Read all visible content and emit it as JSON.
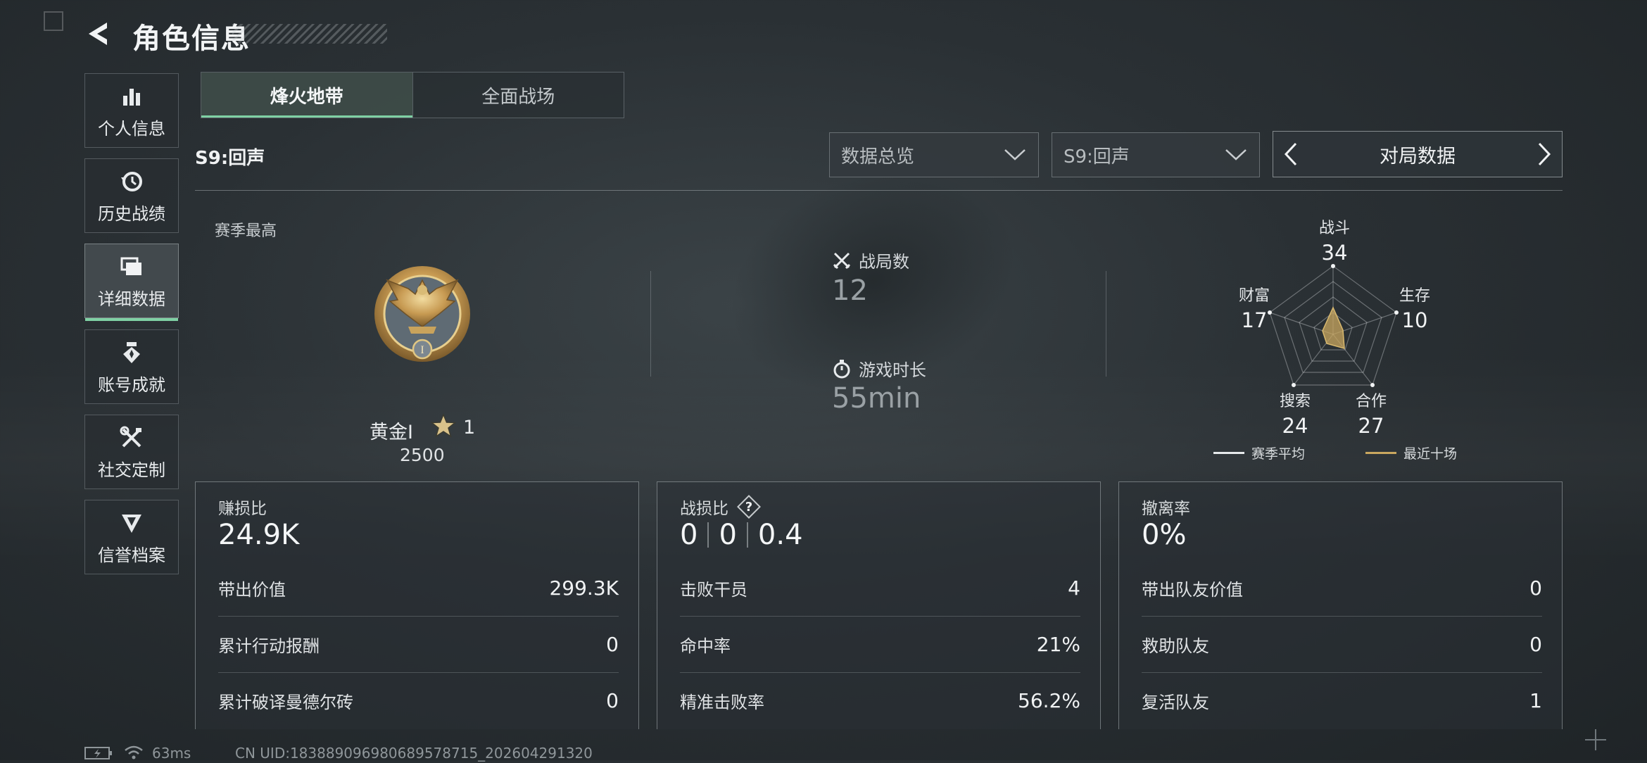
{
  "header": {
    "title": "角色信息"
  },
  "sidebar": {
    "items": [
      {
        "label": "个人信息",
        "icon": "bar-chart-icon"
      },
      {
        "label": "历史战绩",
        "icon": "history-clock-icon"
      },
      {
        "label": "详细数据",
        "icon": "folders-icon",
        "active": true
      },
      {
        "label": "账号成就",
        "icon": "medal-icon"
      },
      {
        "label": "社交定制",
        "icon": "tools-icon"
      },
      {
        "label": "信誉档案",
        "icon": "shield-emblem-icon"
      }
    ]
  },
  "mode_tabs": [
    {
      "label": "烽火地带",
      "active": true
    },
    {
      "label": "全面战场",
      "active": false
    }
  ],
  "season_label": "S9:回声",
  "filters": {
    "data_type": "数据总览",
    "season": "S9:回声",
    "pager_label": "对局数据"
  },
  "season_best": {
    "label": "赛季最高",
    "rank_name": "黄金I",
    "rank_numeral": "I",
    "stars": "1",
    "score": "2500"
  },
  "match_stats": {
    "matches_label": "战局数",
    "matches_value": "12",
    "time_label": "游戏时长",
    "time_value": "55min"
  },
  "radar": {
    "axes": [
      {
        "label": "战斗",
        "value": "34"
      },
      {
        "label": "生存",
        "value": "10"
      },
      {
        "label": "合作",
        "value": "27"
      },
      {
        "label": "搜索",
        "value": "24"
      },
      {
        "label": "财富",
        "value": "17"
      }
    ],
    "legend": [
      {
        "label": "赛季平均",
        "color": "#e6e9eb"
      },
      {
        "label": "最近十场",
        "color": "#c9a75f"
      }
    ]
  },
  "panels": {
    "profit": {
      "title": "赚损比",
      "big": "24.9K",
      "rows": [
        {
          "label": "带出价值",
          "value": "299.3K"
        },
        {
          "label": "累计行动报酬",
          "value": "0"
        },
        {
          "label": "累计破译曼德尔砖",
          "value": "0"
        }
      ]
    },
    "combat": {
      "title": "战损比",
      "help": "?",
      "big_values": [
        "0",
        "0",
        "0.4"
      ],
      "rows": [
        {
          "label": "击败干员",
          "value": "4"
        },
        {
          "label": "命中率",
          "value": "21%"
        },
        {
          "label": "精准击败率",
          "value": "56.2%"
        }
      ]
    },
    "extract": {
      "title": "撤离率",
      "big": "0%",
      "rows": [
        {
          "label": "带出队友价值",
          "value": "0"
        },
        {
          "label": "救助队友",
          "value": "0"
        },
        {
          "label": "复活队友",
          "value": "1"
        }
      ]
    }
  },
  "status_bar": {
    "ping": "63ms",
    "uid": "CN UID:18388909698068957871​5_202604291320"
  }
}
